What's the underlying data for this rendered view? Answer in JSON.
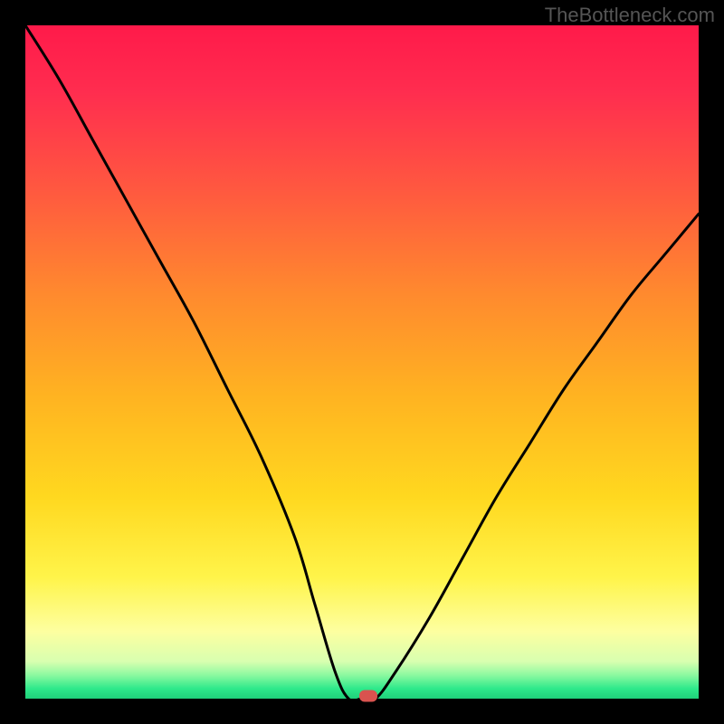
{
  "attribution": "TheBottleneck.com",
  "chart_data": {
    "type": "line",
    "title": "",
    "xlabel": "",
    "ylabel": "",
    "xlim": [
      0,
      100
    ],
    "ylim": [
      0,
      100
    ],
    "gradient_stops": [
      {
        "pos": 0.0,
        "color": "#ff1a4a"
      },
      {
        "pos": 0.1,
        "color": "#ff2d4f"
      },
      {
        "pos": 0.25,
        "color": "#ff5a3f"
      },
      {
        "pos": 0.4,
        "color": "#ff8a2e"
      },
      {
        "pos": 0.55,
        "color": "#ffb321"
      },
      {
        "pos": 0.7,
        "color": "#ffd81f"
      },
      {
        "pos": 0.82,
        "color": "#fff44a"
      },
      {
        "pos": 0.9,
        "color": "#fdffa0"
      },
      {
        "pos": 0.945,
        "color": "#d8ffb0"
      },
      {
        "pos": 0.965,
        "color": "#8cf9a0"
      },
      {
        "pos": 0.985,
        "color": "#2ee98b"
      },
      {
        "pos": 1.0,
        "color": "#1fd07a"
      }
    ],
    "series": [
      {
        "name": "bottleneck_curve",
        "x": [
          0,
          5,
          10,
          15,
          20,
          25,
          30,
          35,
          40,
          43,
          46,
          48,
          50,
          52,
          55,
          60,
          65,
          70,
          75,
          80,
          85,
          90,
          95,
          100
        ],
        "y": [
          100,
          92,
          83,
          74,
          65,
          56,
          46,
          36,
          24,
          14,
          4,
          0,
          0,
          0,
          4,
          12,
          21,
          30,
          38,
          46,
          53,
          60,
          66,
          72
        ]
      }
    ],
    "marker": {
      "x": 51,
      "y": 0,
      "color": "#d9534f"
    }
  }
}
